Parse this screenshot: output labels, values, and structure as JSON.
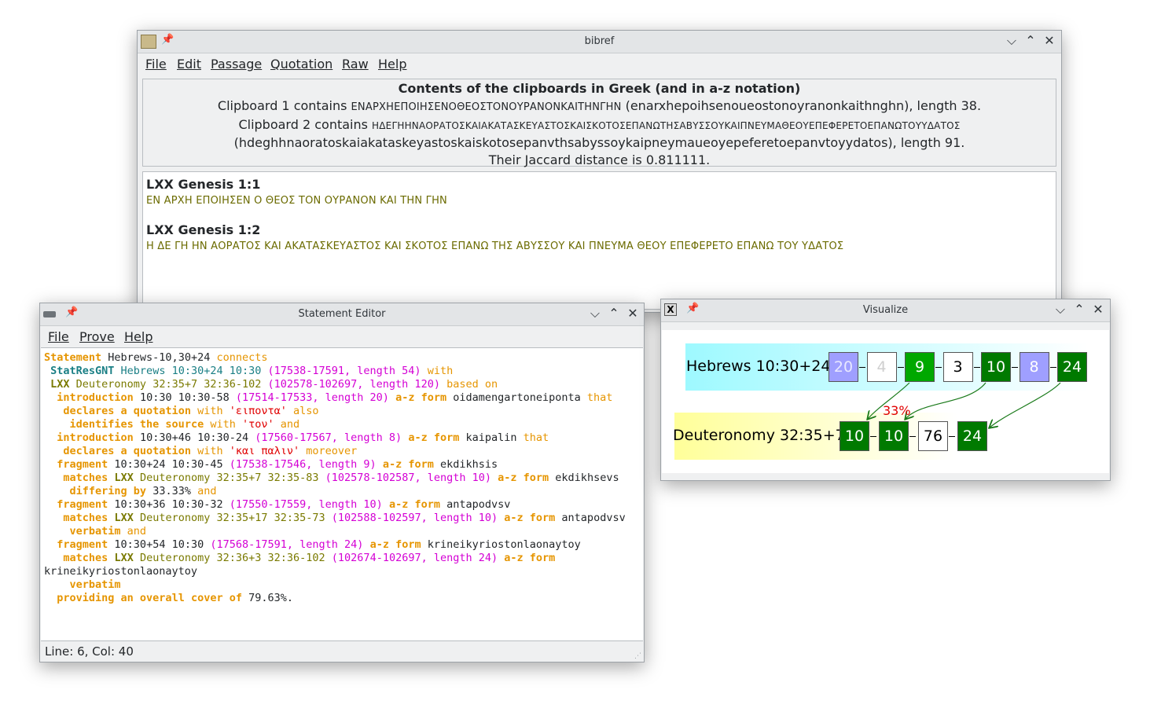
{
  "bibref": {
    "title": "bibref",
    "menu": [
      "File",
      "Edit",
      "Passage",
      "Quotation",
      "Raw",
      "Help"
    ],
    "clipboard_header": "Contents of the clipboards in Greek (and in a-z notation)",
    "clip1_prefix": "Clipboard 1 contains",
    "clip1_greek": "ΕΝΑΡΧΗΕΠΟΙΗΣΕΝΟΘΕΟΣΤΟΝΟΥΡΑΝΟΝΚΑΙΤΗΝΓΗΝ",
    "clip1_suffix": "(enarxhepoihsenoueostonoyranonkaithnghn), length 38.",
    "clip2_prefix": "Clipboard 2 contains",
    "clip2_greek": "ΗΔΕΓΗΗΝΑΟΡΑΤΟΣΚΑΙΑΚΑΤΑΣΚΕΥΑΣΤΟΣΚΑΙΣΚΟΤΟΣΕΠΑΝΩΤΗΣΑΒΥΣΣΟΥΚΑΙΠΝΕΥΜΑΘΕΟΥΕΠΕΦΕΡΕΤΟΕΠΑΝΩΤΟΥΥΔΑΤΟΣ",
    "clip2_suffix": "(hdeghhnaoratoskaiakataskeyastoskaiskotosepanvthsabyssoykaipneymaueoyepeferetoepanvtoyydatos), length 91.",
    "jaccard": "Their Jaccard distance is 0.811111.",
    "passages": [
      {
        "heading": "LXX Genesis 1:1",
        "text": "ΕΝ ΑΡΧΗ ΕΠΟΙΗΣΕΝ Ο ΘΕΟΣ ΤΟΝ ΟΥΡΑΝΟΝ ΚΑΙ ΤΗΝ ΓΗΝ"
      },
      {
        "heading": "LXX Genesis 1:2",
        "text": "Η ΔΕ ΓΗ ΗΝ ΑΟΡΑΤΟΣ ΚΑΙ ΑΚΑΤΑΣΚΕΥΑΣΤΟΣ ΚΑΙ ΣΚΟΤΟΣ ΕΠΑΝΩ ΤΗΣ ΑΒΥΣΣΟΥ ΚΑΙ ΠΝΕΥΜΑ ΘΕΟΥ ΕΠΕΦΕΡΕΤΟ ΕΠΑΝΩ ΤΟΥ ΥΔΑΤΟΣ"
      }
    ]
  },
  "editor": {
    "title": "Statement Editor",
    "menu": [
      "File",
      "Prove",
      "Help"
    ],
    "status": "Line: 6, Col: 40",
    "lines": [
      [
        [
          "k",
          "Statement"
        ],
        [
          "n",
          " Hebrews-10,30+24 "
        ],
        [
          "ko",
          "connects"
        ]
      ],
      [
        [
          "n",
          " "
        ],
        [
          "cb",
          "StatResGNT"
        ],
        [
          "c",
          " Hebrews 10:30+24 10:30 "
        ],
        [
          "m",
          "(17538-17591, length 54)"
        ],
        [
          "ko",
          " with"
        ]
      ],
      [
        [
          "n",
          " "
        ],
        [
          "ob",
          "LXX"
        ],
        [
          "o",
          " Deuteronomy 32:35+7 32:36-102 "
        ],
        [
          "m",
          "(102578-102697, length 120)"
        ],
        [
          "ko",
          " based on"
        ]
      ],
      [
        [
          "n",
          "  "
        ],
        [
          "k",
          "introduction"
        ],
        [
          "n",
          " 10:30 10:30-58 "
        ],
        [
          "m",
          "(17514-17533, length 20)"
        ],
        [
          "n",
          " "
        ],
        [
          "k",
          "a-z form"
        ],
        [
          "n",
          " oidamengartoneiponta "
        ],
        [
          "ko",
          "that"
        ]
      ],
      [
        [
          "n",
          "   "
        ],
        [
          "k",
          "declares a quotation"
        ],
        [
          "ko",
          " with "
        ],
        [
          "r",
          "'ειποντα'"
        ],
        [
          "ko",
          " also"
        ]
      ],
      [
        [
          "n",
          "    "
        ],
        [
          "k",
          "identifies the source"
        ],
        [
          "ko",
          " with "
        ],
        [
          "r",
          "'τον'"
        ],
        [
          "ko",
          " and"
        ]
      ],
      [
        [
          "n",
          "  "
        ],
        [
          "k",
          "introduction"
        ],
        [
          "n",
          " 10:30+46 10:30-24 "
        ],
        [
          "m",
          "(17560-17567, length 8)"
        ],
        [
          "n",
          " "
        ],
        [
          "k",
          "a-z form"
        ],
        [
          "n",
          " kaipalin "
        ],
        [
          "ko",
          "that"
        ]
      ],
      [
        [
          "n",
          "   "
        ],
        [
          "k",
          "declares a quotation"
        ],
        [
          "ko",
          " with "
        ],
        [
          "r",
          "'και παλιν'"
        ],
        [
          "ko",
          " moreover"
        ]
      ],
      [
        [
          "n",
          "  "
        ],
        [
          "k",
          "fragment"
        ],
        [
          "n",
          " 10:30+24 10:30-45 "
        ],
        [
          "m",
          "(17538-17546, length 9)"
        ],
        [
          "n",
          " "
        ],
        [
          "k",
          "a-z form"
        ],
        [
          "n",
          " ekdikhsis"
        ]
      ],
      [
        [
          "n",
          "   "
        ],
        [
          "k",
          "matches"
        ],
        [
          "n",
          " "
        ],
        [
          "ob",
          "LXX"
        ],
        [
          "o",
          " Deuteronomy 32:35+7 32:35-83 "
        ],
        [
          "m",
          "(102578-102587, length 10)"
        ],
        [
          "n",
          " "
        ],
        [
          "k",
          "a-z form"
        ],
        [
          "n",
          " ekdikhsevs"
        ]
      ],
      [
        [
          "n",
          "    "
        ],
        [
          "k",
          "differing by"
        ],
        [
          "n",
          " 33.33% "
        ],
        [
          "ko",
          "and"
        ]
      ],
      [
        [
          "n",
          "  "
        ],
        [
          "k",
          "fragment"
        ],
        [
          "n",
          " 10:30+36 10:30-32 "
        ],
        [
          "m",
          "(17550-17559, length 10)"
        ],
        [
          "n",
          " "
        ],
        [
          "k",
          "a-z form"
        ],
        [
          "n",
          " antapodvsv"
        ]
      ],
      [
        [
          "n",
          "   "
        ],
        [
          "k",
          "matches"
        ],
        [
          "n",
          " "
        ],
        [
          "ob",
          "LXX"
        ],
        [
          "o",
          " Deuteronomy 32:35+17 32:35-73 "
        ],
        [
          "m",
          "(102588-102597, length 10)"
        ],
        [
          "n",
          " "
        ],
        [
          "k",
          "a-z form"
        ],
        [
          "n",
          " antapodvsv"
        ]
      ],
      [
        [
          "n",
          "    "
        ],
        [
          "k",
          "verbatim"
        ],
        [
          "ko",
          " and"
        ]
      ],
      [
        [
          "n",
          "  "
        ],
        [
          "k",
          "fragment"
        ],
        [
          "n",
          " 10:30+54 10:30 "
        ],
        [
          "m",
          "(17568-17591, length 24)"
        ],
        [
          "n",
          " "
        ],
        [
          "k",
          "a-z form"
        ],
        [
          "n",
          " krineikyriostonlaonaytoy"
        ]
      ],
      [
        [
          "n",
          "   "
        ],
        [
          "k",
          "matches"
        ],
        [
          "n",
          " "
        ],
        [
          "ob",
          "LXX"
        ],
        [
          "o",
          " Deuteronomy 32:36+3 32:36-102 "
        ],
        [
          "m",
          "(102674-102697, length 24)"
        ],
        [
          "n",
          " "
        ],
        [
          "k",
          "a-z form"
        ]
      ],
      [
        [
          "n",
          "krineikyriostonlaonaytoy"
        ]
      ],
      [
        [
          "n",
          "    "
        ],
        [
          "k",
          "verbatim"
        ]
      ],
      [
        [
          "n",
          "  "
        ],
        [
          "k",
          "providing an overall cover of"
        ],
        [
          "n",
          " 79.63%."
        ]
      ]
    ]
  },
  "visualize": {
    "title": "Visualize",
    "top_label": "Hebrews 10:30+24",
    "bottom_label": "Deuteronomy 32:35+7",
    "percent_label": "33%",
    "top_boxes": [
      {
        "value": "20",
        "fill": "#9f9fff",
        "text": "#e8e8ff"
      },
      {
        "value": "4",
        "fill": "#ffffff",
        "text": "#cfcfcf"
      },
      {
        "value": "9",
        "fill": "#00a800",
        "text": "#ffffff"
      },
      {
        "value": "3",
        "fill": "#ffffff",
        "text": "#000000"
      },
      {
        "value": "10",
        "fill": "#007a00",
        "text": "#ffffff"
      },
      {
        "value": "8",
        "fill": "#9f9fff",
        "text": "#ffffff"
      },
      {
        "value": "24",
        "fill": "#007a00",
        "text": "#ffffff"
      }
    ],
    "bottom_boxes": [
      {
        "value": "10",
        "fill": "#007a00",
        "text": "#ffffff"
      },
      {
        "value": "10",
        "fill": "#007a00",
        "text": "#ffffff"
      },
      {
        "value": "76",
        "fill": "#ffffff",
        "text": "#000000"
      },
      {
        "value": "24",
        "fill": "#007a00",
        "text": "#ffffff"
      }
    ]
  }
}
